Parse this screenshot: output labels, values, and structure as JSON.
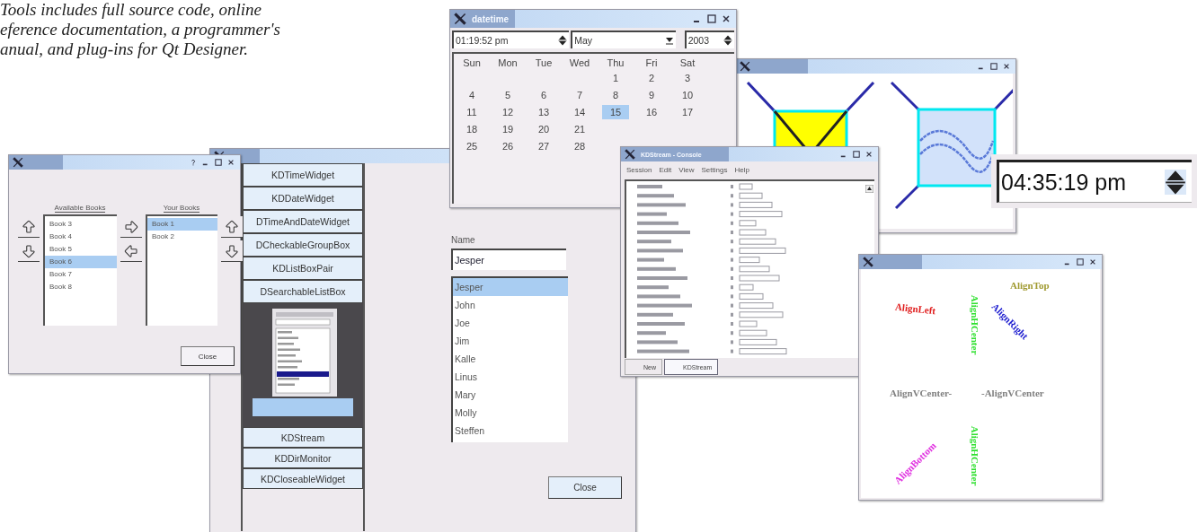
{
  "caption": {
    "lines": [
      "Tools includes full source code, online",
      "eference documentation, a programmer's",
      "anual, and plug-ins for Qt Designer."
    ]
  },
  "stocks_window": {
    "available_label": "Available Books",
    "available": [
      {
        "label": "Book 3",
        "selected": false
      },
      {
        "label": "Book 4",
        "selected": false
      },
      {
        "label": "Book 5",
        "selected": false
      },
      {
        "label": "Book 6",
        "selected": true
      },
      {
        "label": "Book 7",
        "selected": false
      },
      {
        "label": "Book 8",
        "selected": false
      }
    ],
    "chosen_label": "Your Books",
    "chosen": [
      {
        "label": "Book 1",
        "selected": true
      },
      {
        "label": "Book 2",
        "selected": false
      }
    ],
    "close": "Close"
  },
  "toolbox_window": {
    "items_top": [
      "KDTimeWidget",
      "KDDateWidget",
      "DTimeAndDateWidget",
      "DCheckableGroupBox",
      "KDListBoxPair",
      "DSearchableListBox"
    ],
    "items_bottom": [
      "KDStream",
      "KDDirMonitor",
      "KDCloseableWidget"
    ],
    "name_label": "Name",
    "name_value": "Jesper",
    "names": [
      {
        "label": "Jesper",
        "selected": true
      },
      {
        "label": "John",
        "selected": false
      },
      {
        "label": "Joe",
        "selected": false
      },
      {
        "label": "Jim",
        "selected": false
      },
      {
        "label": "Kalle",
        "selected": false
      },
      {
        "label": "Linus",
        "selected": false
      },
      {
        "label": "Mary",
        "selected": false
      },
      {
        "label": "Molly",
        "selected": false
      },
      {
        "label": "Steffen",
        "selected": false
      }
    ],
    "close": "Close"
  },
  "datetime_window": {
    "title": "datetime",
    "time": "01:19:52 pm",
    "month": "May",
    "year": "2003",
    "weekdays": [
      "Sun",
      "Mon",
      "Tue",
      "Wed",
      "Thu",
      "Fri",
      "Sat"
    ],
    "weeks": [
      [
        {
          "label": "1",
          "selected": false
        },
        {
          "label": "2",
          "selected": false
        },
        {
          "label": "3",
          "selected": false
        }
      ],
      [
        {
          "label": "4",
          "selected": false
        },
        {
          "label": "5",
          "selected": false
        },
        {
          "label": "6",
          "selected": false
        },
        {
          "label": "7",
          "selected": false
        },
        {
          "label": "8",
          "selected": false
        },
        {
          "label": "9",
          "selected": false
        },
        {
          "label": "10",
          "selected": false
        }
      ],
      [
        {
          "label": "11",
          "selected": false
        },
        {
          "label": "12",
          "selected": false
        },
        {
          "label": "13",
          "selected": false
        },
        {
          "label": "14",
          "selected": false
        },
        {
          "label": "15",
          "selected": true
        },
        {
          "label": "16",
          "selected": false
        },
        {
          "label": "17",
          "selected": false
        }
      ],
      [
        {
          "label": "18",
          "selected": false
        },
        {
          "label": "19",
          "selected": false
        },
        {
          "label": "20",
          "selected": false
        },
        {
          "label": "21",
          "selected": false
        }
      ],
      [
        {
          "label": "25",
          "selected": false
        },
        {
          "label": "26",
          "selected": false
        },
        {
          "label": "27",
          "selected": false
        },
        {
          "label": "28",
          "selected": false
        }
      ]
    ]
  },
  "time_edit": {
    "value": "04:35:19 pm"
  },
  "console_window": {
    "title": "KDStream - Console",
    "menu": [
      "Session",
      "Edit",
      "View",
      "Settings",
      "Help"
    ],
    "tabs": [
      {
        "label": "New",
        "selected": false
      },
      {
        "label": "KDStream",
        "selected": true
      }
    ]
  },
  "alignment_window": {
    "labels": [
      {
        "kind": "top",
        "text": "AlignTop",
        "color": "#a09a30"
      },
      {
        "kind": "right",
        "text": "AlignRight",
        "color": "#2020d0"
      },
      {
        "kind": "left",
        "text": "AlignLeft",
        "color": "#e02020"
      },
      {
        "kind": "hcenter_top",
        "text": "AlignHCenter",
        "color": "#30e030"
      },
      {
        "kind": "vcenter_left",
        "text": "AlignVCenter-",
        "color": "#808080"
      },
      {
        "kind": "vcenter_right",
        "text": "-AlignVCenter",
        "color": "#808080"
      },
      {
        "kind": "hcenter_bottom",
        "text": "AlignHCenter",
        "color": "#30e030"
      },
      {
        "kind": "bottom",
        "text": "AlignBottom",
        "color": "#e030e0"
      }
    ]
  }
}
